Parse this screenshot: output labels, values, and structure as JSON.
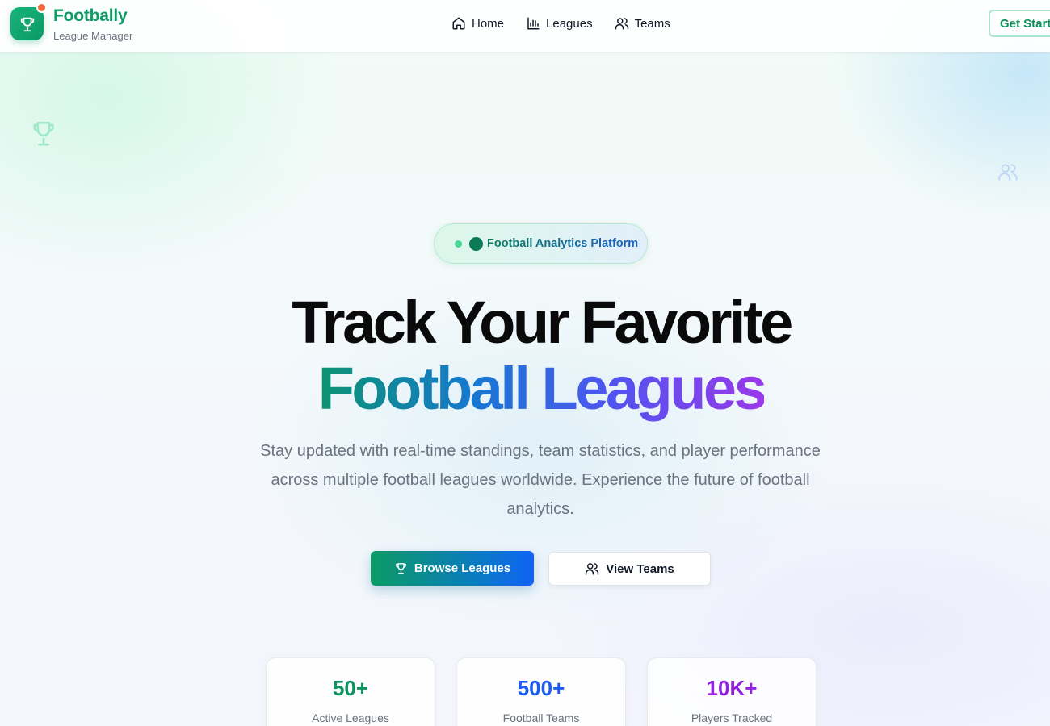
{
  "brand": {
    "name": "Footbally",
    "subtitle": "League Manager"
  },
  "nav": [
    {
      "label": "Home",
      "icon": "home-icon"
    },
    {
      "label": "Leagues",
      "icon": "bar-chart-icon"
    },
    {
      "label": "Teams",
      "icon": "users-icon"
    }
  ],
  "header": {
    "cta_label": "Get Started"
  },
  "hero": {
    "badge": "Football Analytics Platform",
    "title_line1": "Track Your Favorite",
    "title_line2": "Football Leagues",
    "description": "Stay updated with real-time standings, team statistics, and player performance across multiple football leagues worldwide. Experience the future of football analytics.",
    "primary_button": "Browse Leagues",
    "secondary_button": "View Teams"
  },
  "stats": [
    {
      "value": "50+",
      "label": "Active Leagues",
      "color": "#0c9460"
    },
    {
      "value": "500+",
      "label": "Football Teams",
      "color": "#1b5cf0"
    },
    {
      "value": "10K+",
      "label": "Players Tracked",
      "color": "#9422e0"
    }
  ],
  "colors": {
    "brand_green": "#0c9b64",
    "notification_dot": "#f26a3a",
    "gradient_start": "#0b9470",
    "gradient_end": "#9a38ea"
  }
}
